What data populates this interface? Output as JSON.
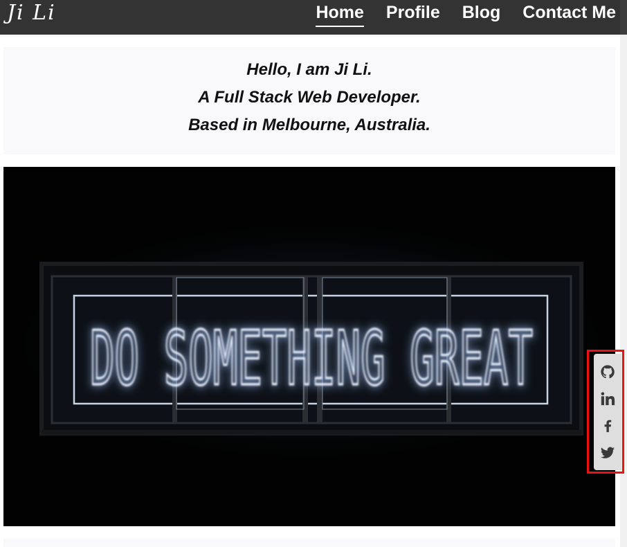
{
  "navbar": {
    "logo": "Ji Li",
    "links": [
      {
        "label": "Home",
        "active": true
      },
      {
        "label": "Profile",
        "active": false
      },
      {
        "label": "Blog",
        "active": false
      },
      {
        "label": "Contact Me",
        "active": false
      }
    ]
  },
  "intro": {
    "lines": [
      "Hello, I am Ji Li.",
      "A Full Stack Web Developer.",
      "Based in Melbourne, Australia."
    ]
  },
  "hero": {
    "neon_text": "DO SOMETHING GREAT"
  },
  "social": {
    "icons": [
      "github-icon",
      "linkedin-icon",
      "facebook-icon",
      "twitter-icon"
    ]
  },
  "colors": {
    "navbar_bg": "#333333",
    "intro_bg": "#f9f9fb",
    "highlight_border": "#ee1111",
    "social_bar_bg": "#dedede",
    "neon": "#eaf2ff"
  }
}
